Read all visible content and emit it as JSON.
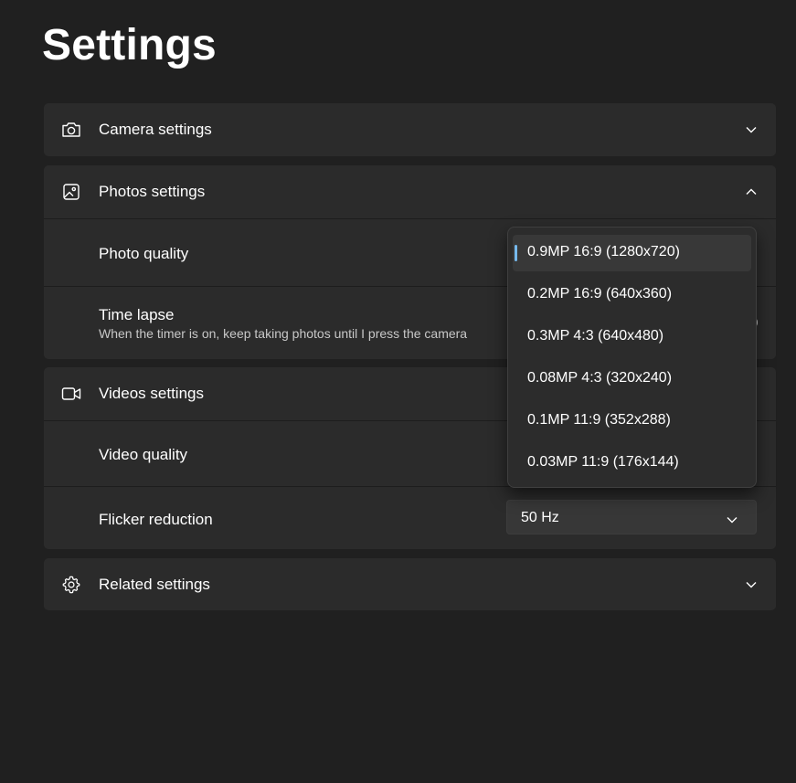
{
  "page_title": "Settings",
  "sections": {
    "camera": {
      "title": "Camera settings",
      "icon": "camera-icon",
      "expanded": false
    },
    "photos": {
      "title": "Photos settings",
      "icon": "image-icon",
      "expanded": true,
      "photo_quality": {
        "label": "Photo quality"
      },
      "time_lapse": {
        "label": "Time lapse",
        "description": "When the timer is on, keep taking photos until I press the camera"
      }
    },
    "videos": {
      "title": "Videos settings",
      "icon": "video-camera-icon",
      "expanded": true,
      "video_quality": {
        "label": "Video quality"
      },
      "flicker_reduction": {
        "label": "Flicker reduction",
        "value": "50 Hz"
      }
    },
    "related": {
      "title": "Related settings",
      "icon": "gear-icon",
      "expanded": false
    }
  },
  "photo_quality_dropdown": {
    "options": [
      "0.9MP 16:9 (1280x720)",
      "0.2MP 16:9 (640x360)",
      "0.3MP 4:3 (640x480)",
      "0.08MP 4:3 (320x240)",
      "0.1MP 11:9 (352x288)",
      "0.03MP 11:9 (176x144)"
    ],
    "selected_index": 0
  },
  "colors": {
    "background": "#202020",
    "card": "#2b2b2b",
    "accent": "#76b9ed",
    "text": "#ffffff",
    "secondary_text": "#c8c8c8"
  }
}
